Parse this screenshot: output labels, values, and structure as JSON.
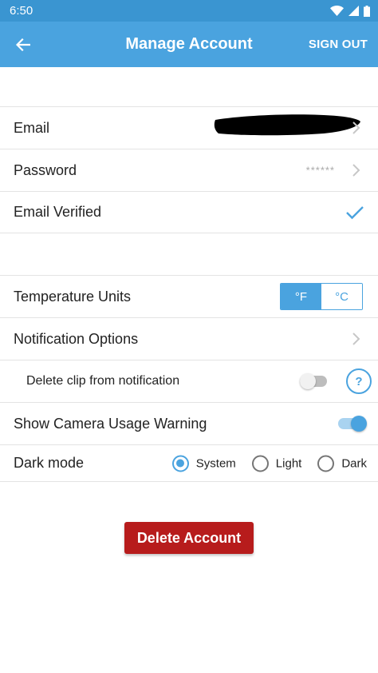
{
  "status_bar": {
    "time": "6:50"
  },
  "header": {
    "title": "Manage Account",
    "sign_out_label": "SIGN OUT"
  },
  "account": {
    "email_label": "Email",
    "password_label": "Password",
    "password_mask": "******",
    "email_verified_label": "Email Verified"
  },
  "settings": {
    "temperature_label": "Temperature Units",
    "temperature_options": [
      "°F",
      "°C"
    ],
    "temperature_selected": "°F",
    "notification_label": "Notification Options",
    "delete_clip_label": "Delete clip from notification",
    "delete_clip_enabled": false,
    "help_label": "?",
    "camera_warning_label": "Show Camera Usage Warning",
    "camera_warning_enabled": true,
    "dark_mode_label": "Dark mode",
    "dark_mode_options": [
      "System",
      "Light",
      "Dark"
    ],
    "dark_mode_selected": "System"
  },
  "delete_account_label": "Delete Account",
  "colors": {
    "app_bar": "#4aa3df",
    "status_bar": "#3a95d1",
    "accent": "#4aa3df",
    "danger": "#b71c1c"
  },
  "icons": {
    "back": "arrow-left-icon",
    "chevron": "chevron-right-icon",
    "check": "checkmark-icon",
    "wifi": "wifi-icon",
    "signal": "signal-icon",
    "battery": "battery-icon"
  }
}
